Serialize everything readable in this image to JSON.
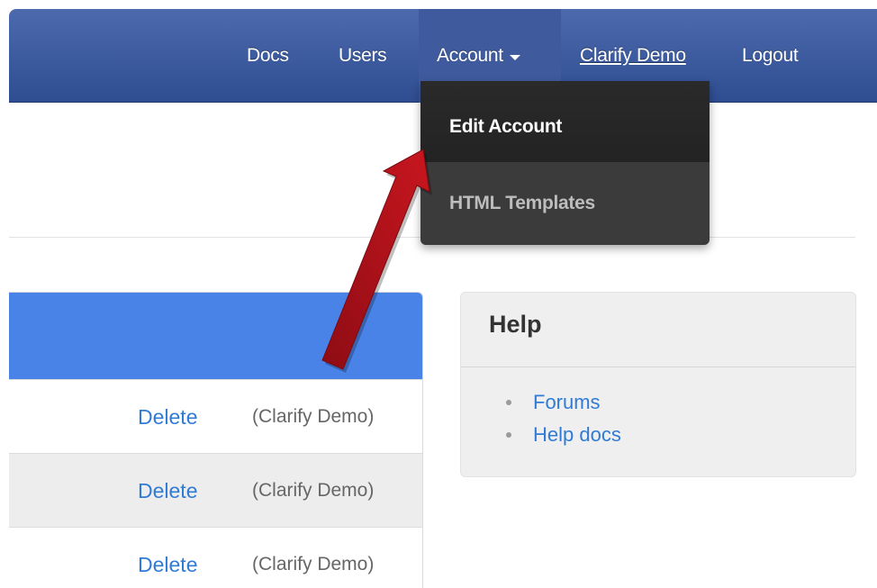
{
  "navbar": {
    "items": [
      {
        "label": "Docs"
      },
      {
        "label": "Users"
      },
      {
        "label": "Account"
      },
      {
        "label": "Clarify Demo"
      },
      {
        "label": "Logout"
      }
    ]
  },
  "dropdown": {
    "items": [
      {
        "label": "Edit Account"
      },
      {
        "label": "HTML Templates"
      }
    ]
  },
  "table": {
    "rows": [
      {
        "action": "Delete",
        "owner": "(Clarify Demo)"
      },
      {
        "action": "Delete",
        "owner": "(Clarify Demo)"
      },
      {
        "action": "Delete",
        "owner": "(Clarify Demo)"
      }
    ]
  },
  "help": {
    "title": "Help",
    "links": [
      {
        "label": "Forums"
      },
      {
        "label": "Help docs"
      }
    ]
  },
  "colors": {
    "navbar": "#3a579b",
    "table_header": "#4a83e8",
    "link": "#2f7bd6",
    "dropdown": "#3b3b3b",
    "arrow": "#b3121b"
  },
  "icons": {
    "account_caret": "chevron-down-icon",
    "annotation": "arrow-icon"
  }
}
